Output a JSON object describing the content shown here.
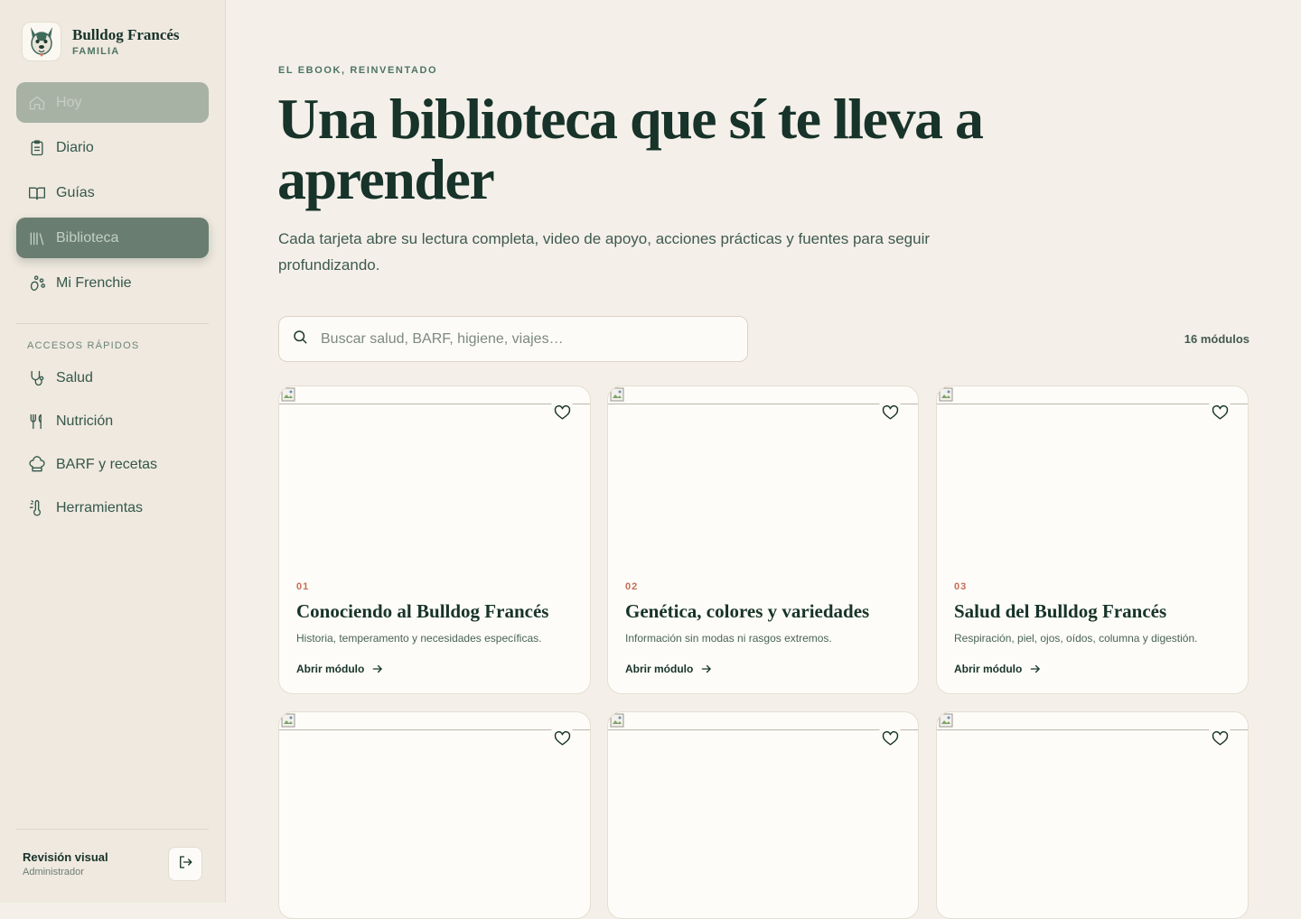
{
  "brand": {
    "name": "Bulldog Francés",
    "subtitle": "FAMILIA"
  },
  "nav": [
    {
      "label": "Hoy",
      "icon": "home-icon",
      "state": "muted"
    },
    {
      "label": "Diario",
      "icon": "clipboard-icon",
      "state": "normal"
    },
    {
      "label": "Guías",
      "icon": "open-book-icon",
      "state": "normal"
    },
    {
      "label": "Biblioteca",
      "icon": "library-icon",
      "state": "active"
    },
    {
      "label": "Mi Frenchie",
      "icon": "paw-icon",
      "state": "normal"
    }
  ],
  "quick_access": {
    "title": "ACCESOS RÁPIDOS",
    "items": [
      {
        "label": "Salud",
        "icon": "stethoscope-icon"
      },
      {
        "label": "Nutrición",
        "icon": "utensils-icon"
      },
      {
        "label": "BARF y recetas",
        "icon": "chef-hat-icon"
      },
      {
        "label": "Herramientas",
        "icon": "thermometer-icon"
      }
    ]
  },
  "user": {
    "name": "Revisión visual",
    "role": "Administrador"
  },
  "header": {
    "eyebrow": "EL EBOOK, REINVENTADO",
    "title": "Una biblioteca que sí te lleva a aprender",
    "subtitle": "Cada tarjeta abre su lectura completa, video de apoyo, acciones prácticas y fuentes para seguir profundizando."
  },
  "search": {
    "placeholder": "Buscar salud, BARF, higiene, viajes…",
    "value": ""
  },
  "module_count": "16 módulos",
  "open_label": "Abrir módulo",
  "modules": [
    {
      "number": "01",
      "title": "Conociendo al Bulldog Francés",
      "description": "Historia, temperamento y necesidades específicas."
    },
    {
      "number": "02",
      "title": "Genética, colores y variedades",
      "description": "Información sin modas ni rasgos extremos."
    },
    {
      "number": "03",
      "title": "Salud del Bulldog Francés",
      "description": "Respiración, piel, ojos, oídos, columna y digestión."
    },
    {
      "number": "",
      "title": "",
      "description": ""
    },
    {
      "number": "",
      "title": "",
      "description": ""
    },
    {
      "number": "",
      "title": "",
      "description": ""
    }
  ],
  "colors": {
    "accent": "#697e71",
    "number": "#c96c56",
    "text": "#17332a",
    "background": "#f4f0e9"
  }
}
